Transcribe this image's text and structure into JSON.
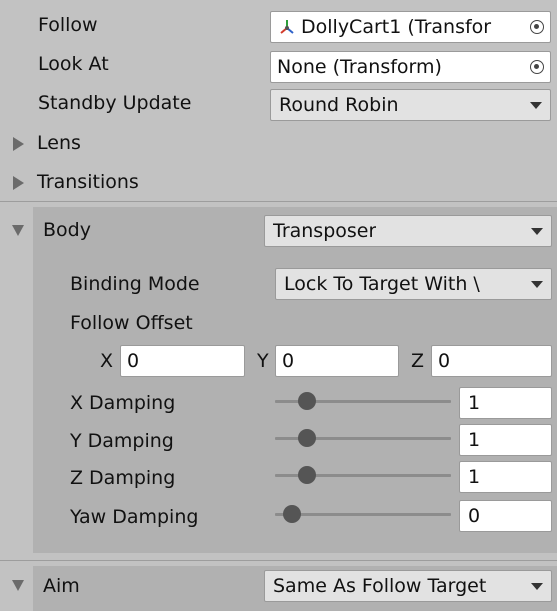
{
  "follow": {
    "label": "Follow",
    "value": "DollyCart1 (Transfor"
  },
  "look_at": {
    "label": "Look At",
    "value": "None (Transform)"
  },
  "standby": {
    "label": "Standby Update",
    "value": "Round Robin"
  },
  "lens": {
    "label": "Lens"
  },
  "transitions": {
    "label": "Transitions"
  },
  "body": {
    "label": "Body",
    "value": "Transposer",
    "binding_mode": {
      "label": "Binding Mode",
      "value": "Lock To Target With \\"
    },
    "follow_offset": {
      "label": "Follow Offset",
      "x_label": "X",
      "x_value": "0",
      "y_label": "Y",
      "y_value": "0",
      "z_label": "Z",
      "z_value": "0"
    },
    "x_damping": {
      "label": "X Damping",
      "value": "1",
      "fraction": 0.1
    },
    "y_damping": {
      "label": "Y Damping",
      "value": "1",
      "fraction": 0.1
    },
    "z_damping": {
      "label": "Z Damping",
      "value": "1",
      "fraction": 0.1
    },
    "yaw_damping": {
      "label": "Yaw Damping",
      "value": "0",
      "fraction": 0.0
    }
  },
  "aim": {
    "label": "Aim",
    "value": "Same As Follow Target"
  }
}
